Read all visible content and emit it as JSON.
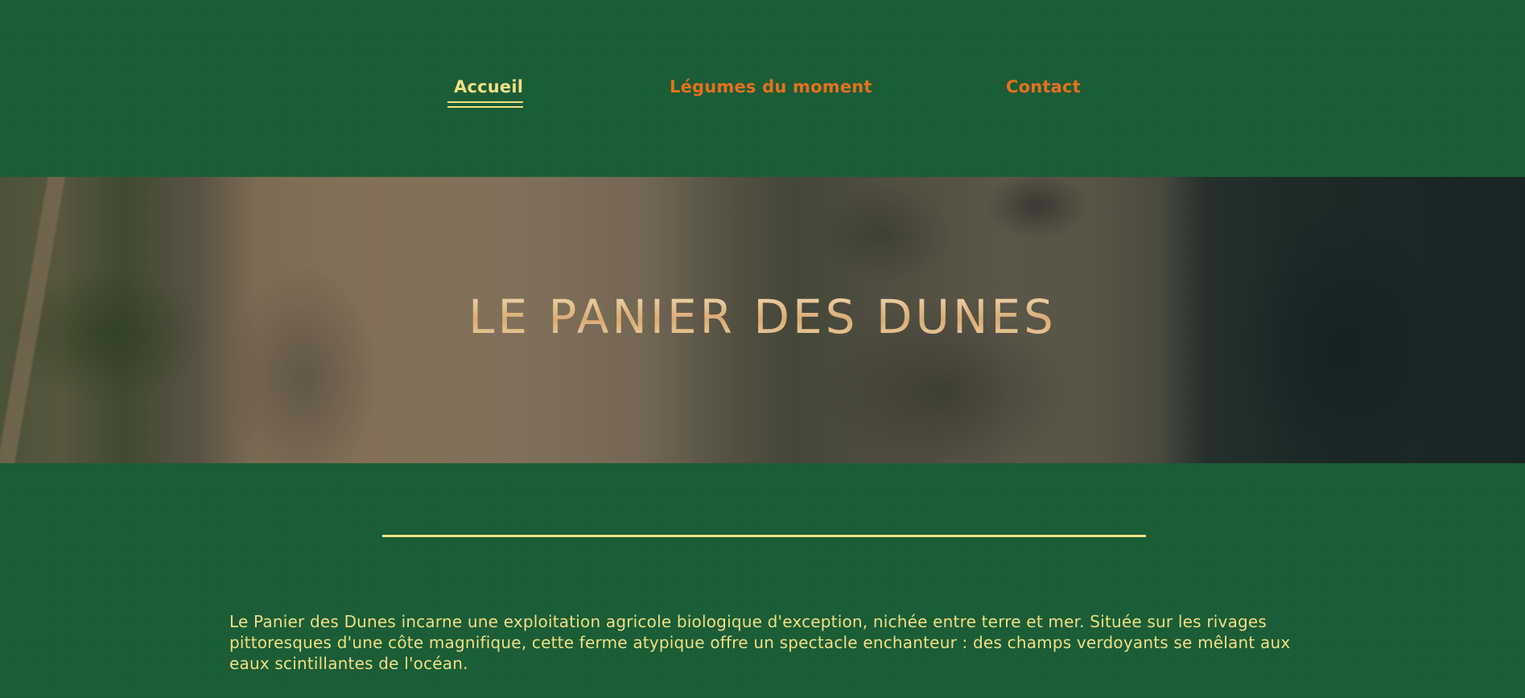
{
  "nav": {
    "items": [
      {
        "label": "Accueil",
        "active": true
      },
      {
        "label": "Légumes du moment",
        "active": false
      },
      {
        "label": "Contact",
        "active": false
      }
    ]
  },
  "hero": {
    "title": "LE PANIER DES DUNES"
  },
  "intro": {
    "text": "Le Panier des Dunes incarne une exploitation agricole biologique d'exception, nichée entre terre et mer. Située sur les rivages pittoresques d'une côte magnifique, cette ferme atypique offre un spectacle enchanteur : des champs verdoyants se mêlant aux eaux scintillantes de l'océan."
  },
  "colors": {
    "background": "#1a5d36",
    "nav_active": "#f2df84",
    "nav_inactive": "#e8701d",
    "text": "#f2df84",
    "divider": "#f2df84",
    "title_gold": "#e9c89a"
  }
}
